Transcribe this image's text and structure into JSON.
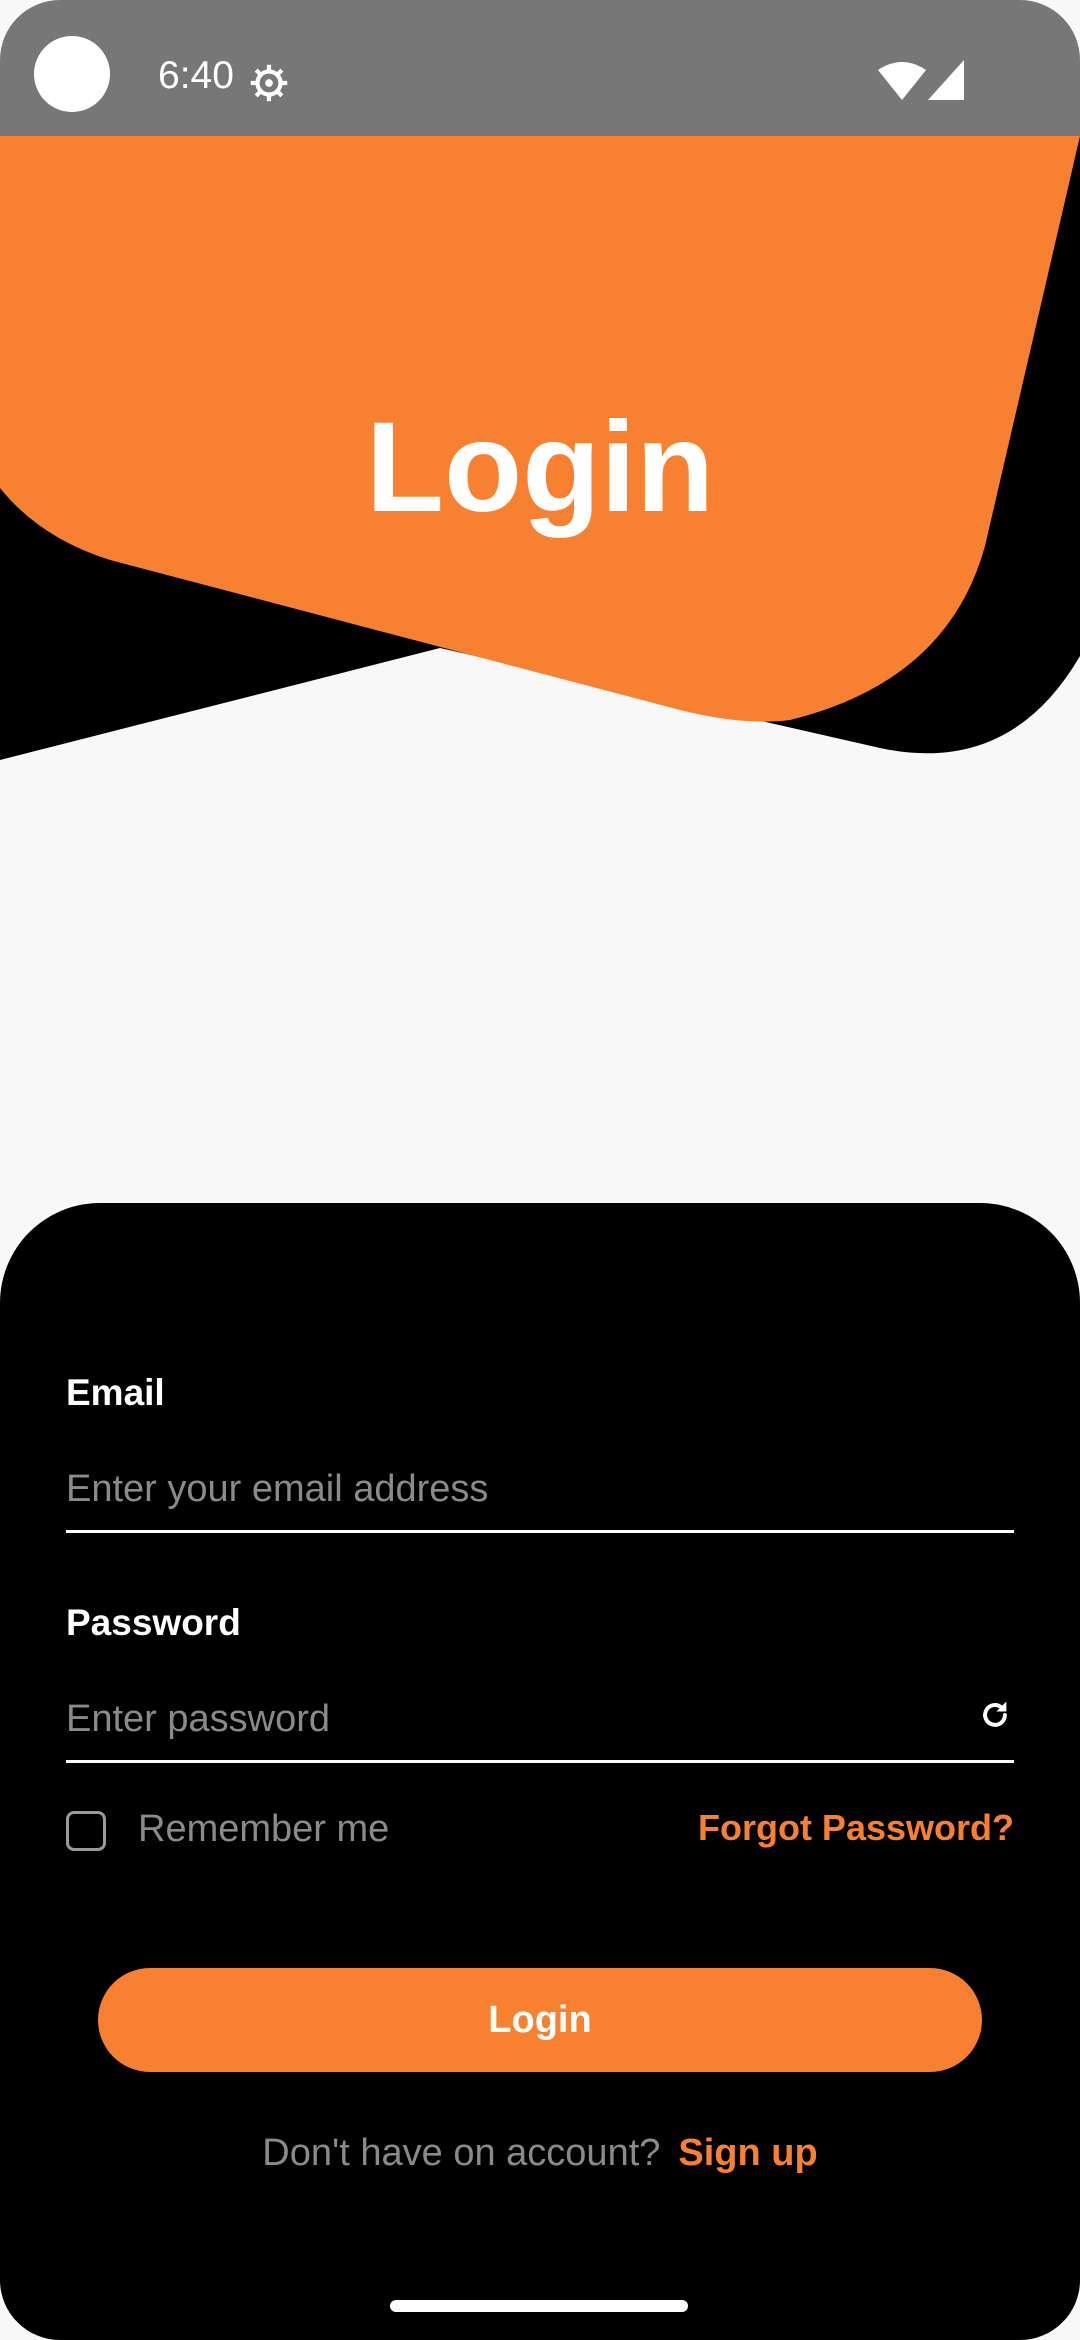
{
  "status_bar": {
    "time": "6:40",
    "icons": [
      "camera-dot",
      "settings-icon",
      "wifi-icon",
      "cellular-signal-icon"
    ]
  },
  "hero": {
    "title": "Login"
  },
  "form": {
    "email": {
      "label": "Email",
      "placeholder": "Enter your email address",
      "value": ""
    },
    "password": {
      "label": "Password",
      "placeholder": "Enter password",
      "value": "",
      "icon": "refresh-icon"
    },
    "remember_me": {
      "label": "Remember me",
      "checked": false
    },
    "forgot_password": "Forgot Password?",
    "login_button": "Login",
    "signup_prompt": "Don't have on account?",
    "signup_link": "Sign up"
  },
  "colors": {
    "accent": "#f78130",
    "card_background": "#000000",
    "page_background": "#f8f8f8",
    "status_bar": "#777777"
  }
}
